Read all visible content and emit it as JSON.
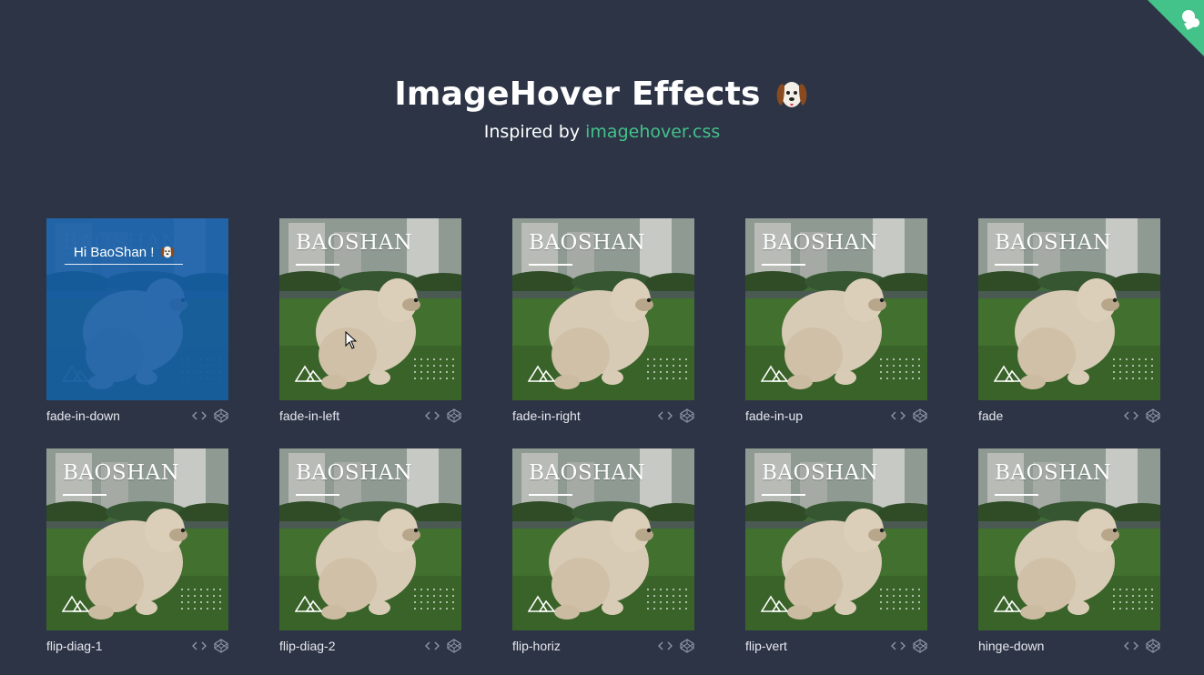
{
  "header": {
    "title": "ImageHover Effects",
    "title_icon": "dog-face-icon",
    "subtitle_prefix": "Inspired by",
    "subtitle_link": "imagehover.css"
  },
  "colors": {
    "background": "#2d3446",
    "link": "#43c28a",
    "overlay": "#125caa",
    "corner_badge": "#43c28a"
  },
  "card_brand": "BAOSHAN",
  "hover_text": "Hi BaoShan !",
  "cards": [
    {
      "label": "fade-in-down",
      "hovered": true
    },
    {
      "label": "fade-in-left",
      "hovered": false
    },
    {
      "label": "fade-in-right",
      "hovered": false
    },
    {
      "label": "fade-in-up",
      "hovered": false
    },
    {
      "label": "fade",
      "hovered": false
    },
    {
      "label": "flip-diag-1",
      "hovered": false
    },
    {
      "label": "flip-diag-2",
      "hovered": false
    },
    {
      "label": "flip-horiz",
      "hovered": false
    },
    {
      "label": "flip-vert",
      "hovered": false
    },
    {
      "label": "hinge-down",
      "hovered": false
    }
  ]
}
